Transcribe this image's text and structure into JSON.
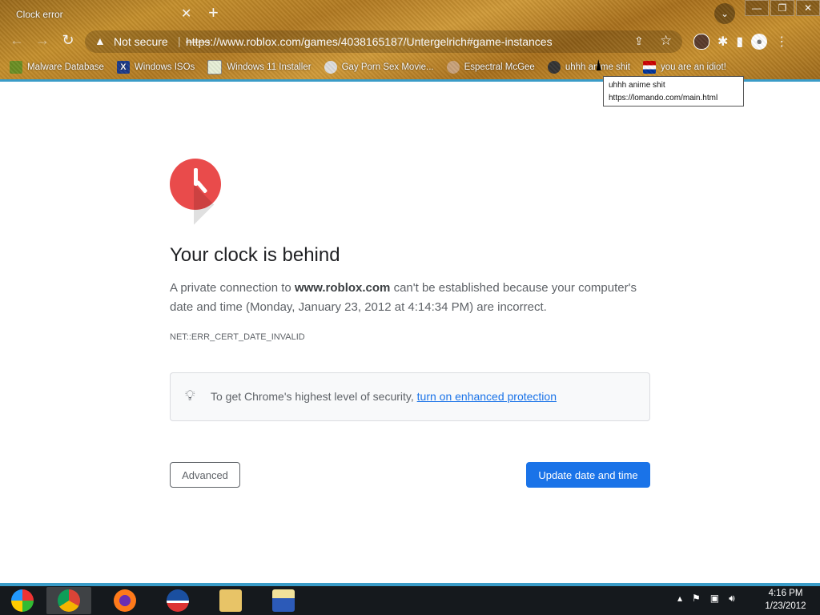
{
  "tab": {
    "title": "Clock error",
    "close": "✕",
    "new_tab": "+"
  },
  "window_controls": [
    "—",
    "❐",
    "✕"
  ],
  "omnibox": {
    "security": "Not secure",
    "url_scheme": "https",
    "url_rest": "://www.roblox.com/games/4038165187/Untergelrich#game-instances"
  },
  "bookmarks": [
    {
      "label": "Malware Database",
      "icon": "bookmark-malware-icon"
    },
    {
      "label": "Windows ISOs",
      "icon": "bookmark-x-icon"
    },
    {
      "label": "Windows 11 Installer",
      "icon": "bookmark-image-icon"
    },
    {
      "label": "Gay Porn Sex Movie...",
      "icon": "bookmark-face-icon"
    },
    {
      "label": "Espectral McGee",
      "icon": "bookmark-face-icon"
    },
    {
      "label": "uhhh anime shit",
      "icon": "bookmark-anime-icon"
    },
    {
      "label": "you are an idiot!",
      "icon": "bookmark-flag-icon"
    }
  ],
  "tooltip": {
    "line1": "uhhh anime shit",
    "line2": "https://lomando.com/main.html"
  },
  "error": {
    "heading": "Your clock is behind",
    "desc_pre": "A private connection to ",
    "desc_host": "www.roblox.com",
    "desc_post": " can't be established because your computer's date and time (Monday, January 23, 2012 at 4:14:34 PM) are incorrect.",
    "code": "NET::ERR_CERT_DATE_INVALID",
    "tip_text": "To get Chrome's highest level of security, ",
    "tip_link": "turn on enhanced protection",
    "advanced_label": "Advanced",
    "update_label": "Update date and time"
  },
  "taskbar": {
    "time": "4:16 PM",
    "date": "1/23/2012"
  },
  "colors": {
    "accent": "#1a73e8",
    "clock_red": "#e94b4b",
    "taskbar_line": "#3a9cc8"
  }
}
